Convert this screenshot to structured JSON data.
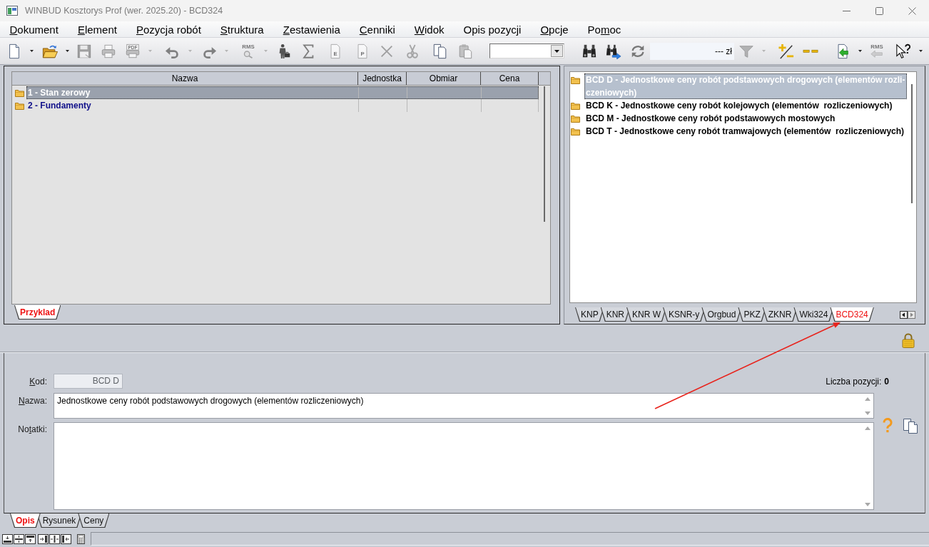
{
  "window": {
    "title": "WINBUD Kosztorys Prof (wer. 2025.20) - BCD324"
  },
  "menu": [
    {
      "accel": "D",
      "post": "okument"
    },
    {
      "accel": "E",
      "post": "lement"
    },
    {
      "accel": "P",
      "post": "ozycja robót"
    },
    {
      "accel": "S",
      "post": "truktura"
    },
    {
      "accel": "Z",
      "post": "estawienia"
    },
    {
      "accel": "C",
      "post": "enniki"
    },
    {
      "accel": "W",
      "post": "idok"
    },
    {
      "pre": "Opis pozycji"
    },
    {
      "accel": "O",
      "post": "pcje"
    },
    {
      "pre": "Po",
      "accel": "m",
      "post": "oc"
    }
  ],
  "toolbar": [
    {
      "kind": "button",
      "disabled": false,
      "dropdown": true
    },
    {
      "kind": "button",
      "disabled": false,
      "dropdown": true
    },
    {
      "kind": "button",
      "disabled": true,
      "dropdown": false
    },
    {
      "kind": "button",
      "disabled": true,
      "dropdown": false
    },
    {
      "kind": "button",
      "disabled": true,
      "dropdown": true,
      "glyph": "PDF"
    },
    {
      "kind": "button",
      "disabled": true,
      "dropdown": true
    },
    {
      "kind": "button",
      "disabled": true,
      "dropdown": true
    },
    {
      "kind": "button",
      "disabled": true,
      "dropdown": true,
      "glyph": "RMS"
    },
    {
      "kind": "button",
      "disabled": false,
      "dropdown": false
    },
    {
      "kind": "button",
      "disabled": false,
      "dropdown": false
    },
    {
      "kind": "button",
      "disabled": true,
      "dropdown": false,
      "glyph": "E"
    },
    {
      "kind": "button",
      "disabled": true,
      "dropdown": false,
      "glyph": "P"
    },
    {
      "kind": "button",
      "disabled": true,
      "dropdown": false
    },
    {
      "kind": "button",
      "disabled": true,
      "dropdown": false
    },
    {
      "kind": "button",
      "disabled": false,
      "dropdown": false
    },
    {
      "kind": "button",
      "disabled": true,
      "dropdown": false
    },
    {
      "kind": "combo"
    },
    {
      "kind": "button",
      "disabled": false,
      "dropdown": false
    },
    {
      "kind": "button",
      "disabled": false,
      "dropdown": false
    },
    {
      "kind": "button",
      "disabled": false,
      "dropdown": false
    },
    {
      "kind": "price",
      "value": "--- zł"
    },
    {
      "kind": "button",
      "disabled": true,
      "dropdown": true
    },
    {
      "kind": "button",
      "disabled": false,
      "dropdown": false
    },
    {
      "kind": "button",
      "disabled": false,
      "dropdown": false
    },
    {
      "kind": "button",
      "disabled": false,
      "dropdown": true
    },
    {
      "kind": "button",
      "disabled": true,
      "dropdown": false,
      "glyph": "RMS"
    },
    {
      "kind": "button",
      "disabled": false,
      "dropdown": true
    }
  ],
  "estimate": {
    "columns": [
      "Nazwa",
      "Jednostka",
      "Obmiar",
      "Cena"
    ],
    "rows": [
      {
        "name": "1 - Stan zerowy",
        "selected": true
      },
      {
        "name": "2 - Fundamenty",
        "selected": false
      }
    ],
    "tabs": [
      {
        "label": "Przyklad",
        "selected": true
      }
    ]
  },
  "catalog": {
    "items": [
      {
        "label": "BCD D - Jednostkowe ceny robót podstawowych drogowych (elementów rozli-czeniowych)",
        "selected": true
      },
      {
        "label": "BCD K - Jednostkowe ceny robót kolejowych (elementów  rozliczeniowych)",
        "selected": false
      },
      {
        "label": "BCD M - Jednostkowe ceny robót podstawowych mostowych",
        "selected": false
      },
      {
        "label": "BCD T - Jednostkowe ceny robót tramwajowych (elementów  rozliczeniowych)",
        "selected": false
      }
    ],
    "tabs": [
      {
        "label": "KNP",
        "selected": false
      },
      {
        "label": "KNR",
        "selected": false
      },
      {
        "label": "KNR W",
        "selected": false
      },
      {
        "label": "KSNR-y",
        "selected": false
      },
      {
        "label": "Orgbud",
        "selected": false
      },
      {
        "label": "PKZ",
        "selected": false
      },
      {
        "label": "ZKNR",
        "selected": false
      },
      {
        "label": "Wki324",
        "selected": false
      },
      {
        "label": "BCD324",
        "selected": true
      }
    ]
  },
  "details": {
    "code": {
      "label": {
        "accel": "K",
        "post": "od:"
      },
      "value": "BCD D",
      "disabled": true
    },
    "count": {
      "label": "Liczba pozycji:",
      "value": "0"
    },
    "name": {
      "label": {
        "accel": "N",
        "post": "azwa:"
      },
      "value": "Jednostkowe ceny robót podstawowych drogowych (elementów rozliczeniowych)"
    },
    "notes": {
      "label": {
        "pre": "No",
        "accel": "t",
        "post": "atki:"
      }
    }
  },
  "bottom_tabs": [
    {
      "label": "Opis",
      "selected": true
    },
    {
      "label": "Rysunek",
      "selected": false
    },
    {
      "label": "Ceny",
      "selected": false
    }
  ]
}
